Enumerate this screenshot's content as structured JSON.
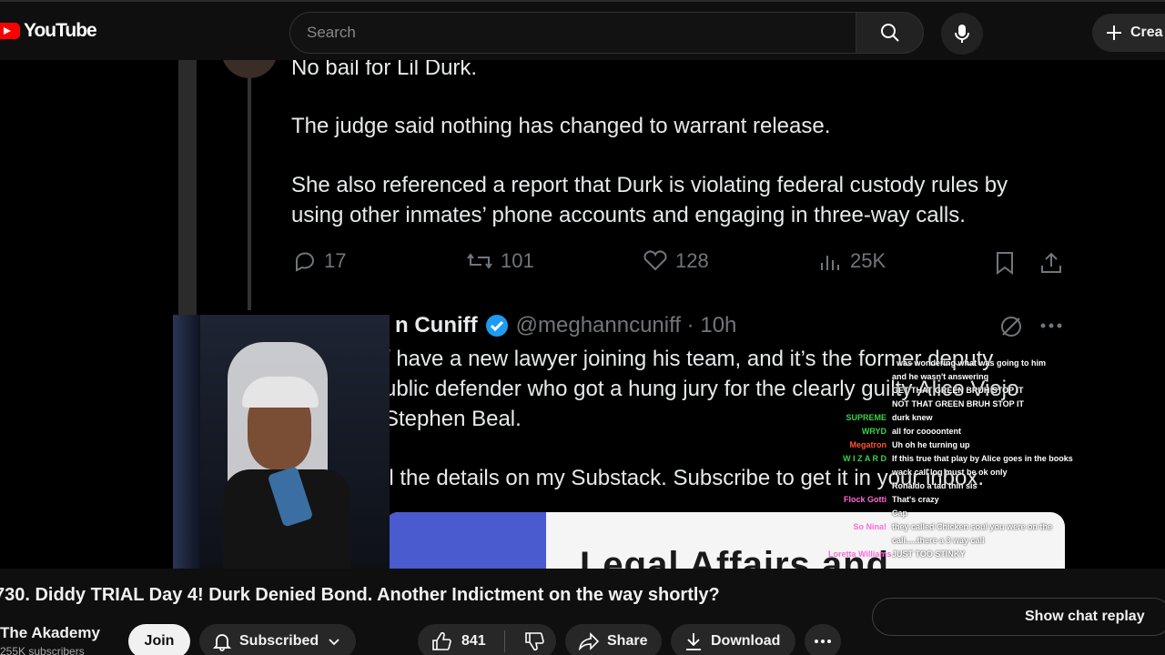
{
  "header": {
    "logo_text": "YouTube",
    "search_placeholder": "Search",
    "create_label": "Crea"
  },
  "video_content": {
    "tweet1_lines": [
      "No bail for Lil Durk.",
      "The judge said nothing has changed to warrant release.",
      "She also referenced a report that Durk is violating federal custody rules by",
      "using other inmates’ phone accounts and engaging in three-way calls."
    ],
    "tweet1_stats": {
      "replies": "17",
      "reposts": "101",
      "likes": "128",
      "views": "25K"
    },
    "tweet2_name": "n Cuniff",
    "tweet2_handle": "@meghanncuniff · 10h",
    "tweet2_lines": [
      "/ have a new lawyer joining his team, and it’s the former deputy",
      "ublic defender who got a hung jury for the clearly guilty Alice Viejo",
      "Stephen Beal.",
      "ll the details on my Substack. Subscribe to get it in your inbox."
    ],
    "card_title": "Legal Affairs and",
    "chat": [
      {
        "name": "",
        "color": "#c44dff",
        "msg": "I was wondering what was going to him"
      },
      {
        "name": "",
        "color": "#c44dff",
        "msg": "and he wasn't answering"
      },
      {
        "name": "",
        "color": "#ff5d5d",
        "msg": "GET THAT GREEN BRUH STOP IT"
      },
      {
        "name": "",
        "color": "#ff5d5d",
        "msg": "NOT THAT GREEN BRUH STOP IT"
      },
      {
        "name": "SUPREME",
        "color": "#36d24a",
        "msg": "durk knew"
      },
      {
        "name": "WRYD",
        "color": "#36d24a",
        "msg": "all for coooontent"
      },
      {
        "name": "Megatron",
        "color": "#ff5533",
        "msg": "Uh oh he turning up"
      },
      {
        "name": "W I Z A R D",
        "color": "#36d24a",
        "msg": "If this true that play by Alice goes in the books"
      },
      {
        "name": "",
        "color": "#ff5d5d",
        "msg": "wack call log must be ok only"
      },
      {
        "name": "",
        "color": "#ff6ad5",
        "msg": "Ronaldo a tad thin sis"
      },
      {
        "name": "Flock Gotti",
        "color": "#ff6ad5",
        "msg": "That's crazy"
      },
      {
        "name": "",
        "color": "#ff5d5d",
        "msg": "Cap"
      },
      {
        "name": "So Nina!",
        "color": "#ff6ad5",
        "msg": "they called Chicken soul you were on the"
      },
      {
        "name": "",
        "color": "#ff6ad5",
        "msg": "call.....there a 3 way call"
      },
      {
        "name": "Loretta Williams",
        "color": "#ff6ad5",
        "msg": "JUST TOO STINKY"
      }
    ]
  },
  "below": {
    "title": "730. Diddy TRIAL Day 4! Durk Denied Bond. Another Indictment on the way shortly?",
    "channel": "The Akademy",
    "subs": "255K subscribers",
    "join": "Join",
    "subscribed": "Subscribed",
    "likes": "841",
    "share": "Share",
    "download": "Download",
    "chat_replay": "Show chat replay"
  }
}
